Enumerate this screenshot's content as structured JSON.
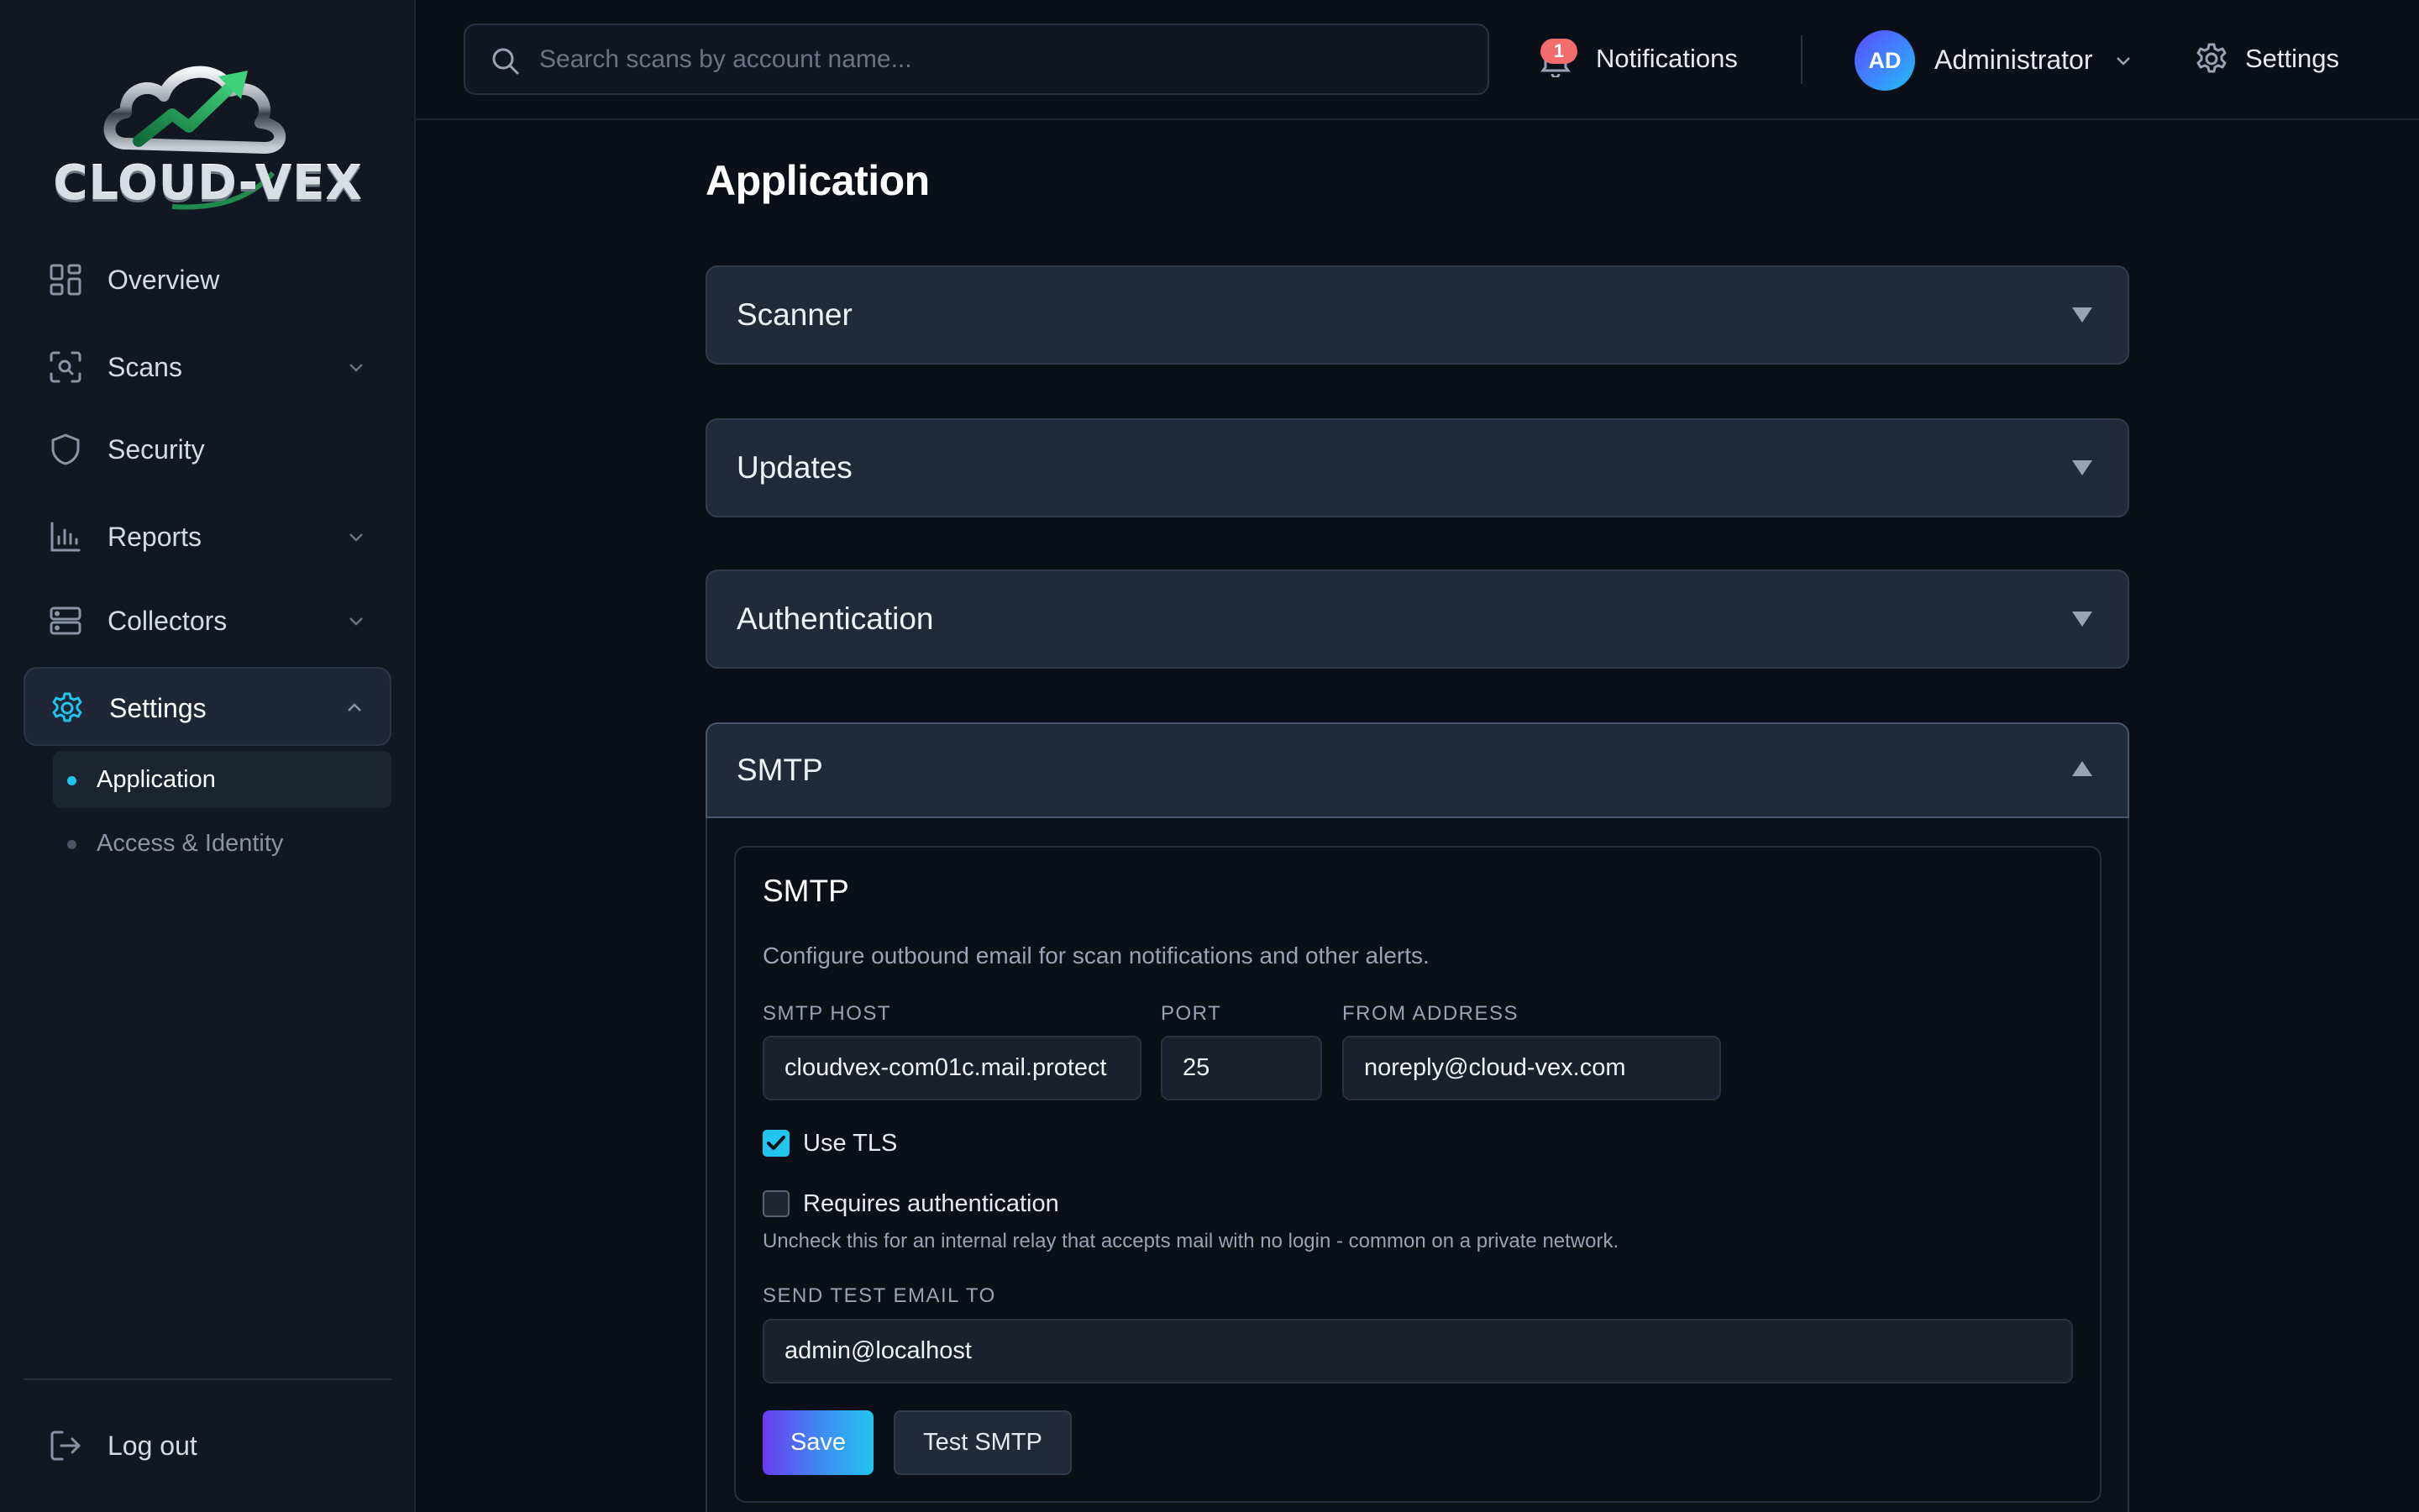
{
  "brand": {
    "logo_text": "CLOUD-VEX"
  },
  "sidebar": {
    "items": [
      {
        "label": "Overview",
        "icon": "grid-icon"
      },
      {
        "label": "Scans",
        "icon": "scan-icon",
        "expandable": true
      },
      {
        "label": "Security",
        "icon": "shield-icon"
      },
      {
        "label": "Reports",
        "icon": "bar-chart-icon",
        "expandable": true
      },
      {
        "label": "Collectors",
        "icon": "server-icon",
        "expandable": true
      },
      {
        "label": "Settings",
        "icon": "gear-icon",
        "expandable": true,
        "expanded": true,
        "active": true
      }
    ],
    "subitems": [
      {
        "label": "Application",
        "active": true
      },
      {
        "label": "Access & Identity",
        "active": false
      }
    ],
    "logout": {
      "label": "Log out",
      "icon": "logout-icon"
    }
  },
  "topbar": {
    "search": {
      "placeholder": "Search scans by account name...",
      "value": ""
    },
    "notifications": {
      "label": "Notifications",
      "count": "1"
    },
    "user": {
      "initials": "AD",
      "name": "Administrator"
    },
    "settings_label": "Settings"
  },
  "main": {
    "title": "Application",
    "sections": [
      {
        "label": "Scanner",
        "open": false
      },
      {
        "label": "Updates",
        "open": false
      },
      {
        "label": "Authentication",
        "open": false
      },
      {
        "label": "SMTP",
        "open": true
      }
    ],
    "smtp": {
      "title": "SMTP",
      "description": "Configure outbound email for scan notifications and other alerts.",
      "host_label": "SMTP HOST",
      "host_value": "cloudvex-com01c.mail.protect",
      "port_label": "PORT",
      "port_value": "25",
      "from_label": "FROM ADDRESS",
      "from_value": "noreply@cloud-vex.com",
      "use_tls_label": "Use TLS",
      "use_tls_checked": true,
      "requires_auth_label": "Requires authentication",
      "requires_auth_checked": false,
      "requires_auth_hint": "Uncheck this for an internal relay that accepts mail with no login - common on a private network.",
      "test_email_label": "SEND TEST EMAIL TO",
      "test_email_value": "admin@localhost",
      "save_label": "Save",
      "test_label": "Test SMTP"
    }
  },
  "colors": {
    "background": "#0b0f17",
    "sidebar": "#121722",
    "accent": "#22c4ee",
    "accent_purple": "#6a3df0",
    "badge": "#f26d6d"
  }
}
